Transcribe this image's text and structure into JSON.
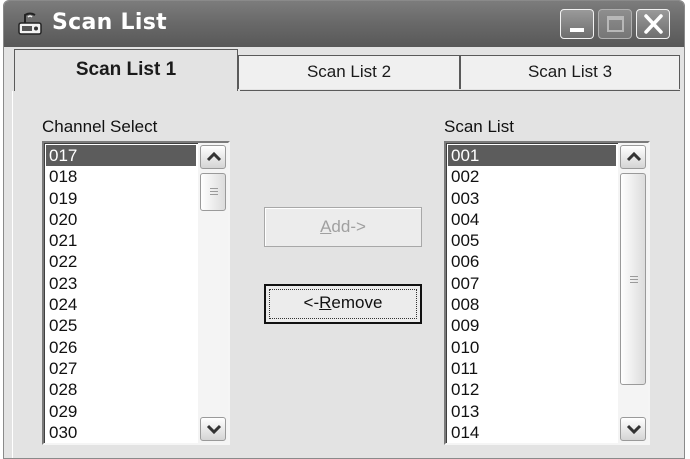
{
  "window": {
    "title": "Scan List"
  },
  "tabs": [
    {
      "label": "Scan List 1",
      "active": true
    },
    {
      "label": "Scan List 2",
      "active": false
    },
    {
      "label": "Scan List 3",
      "active": false
    }
  ],
  "channel_select": {
    "label": "Channel Select",
    "items": [
      "017",
      "018",
      "019",
      "020",
      "021",
      "022",
      "023",
      "024",
      "025",
      "026",
      "027",
      "028",
      "029",
      "030"
    ],
    "selected": "017"
  },
  "scan_list": {
    "label": "Scan List",
    "items": [
      "001",
      "002",
      "003",
      "004",
      "005",
      "006",
      "007",
      "008",
      "009",
      "010",
      "011",
      "012",
      "013",
      "014"
    ],
    "selected": "001"
  },
  "buttons": {
    "add": {
      "label_prefix": "",
      "mnemonic": "A",
      "label_suffix": "dd->",
      "enabled": false
    },
    "remove": {
      "label_prefix": "<-",
      "mnemonic": "R",
      "label_suffix": "emove",
      "enabled": true
    }
  },
  "colors": {
    "titlebar": "#6a6a6a",
    "window_bg": "#e3e3e3",
    "selection": "#5c5c5c"
  }
}
